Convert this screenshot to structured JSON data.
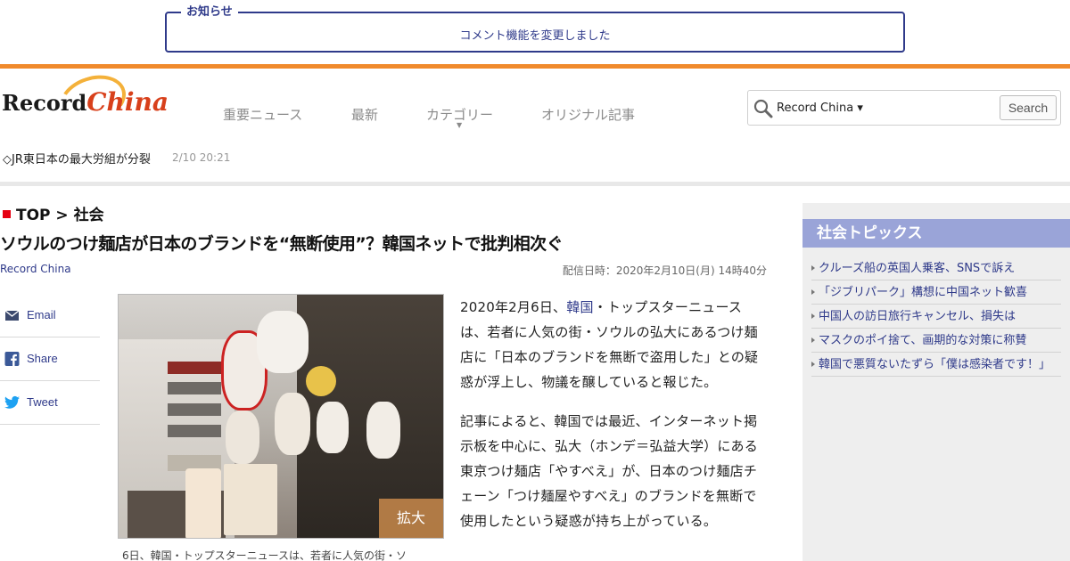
{
  "notice": {
    "label": "お知らせ",
    "text": "コメント機能を変更しました"
  },
  "brand": {
    "logo_text_left": "Record",
    "logo_text_right": "China",
    "accent_orange": "#f08a2c",
    "accent_navy": "#2f3a8a"
  },
  "nav": {
    "items": [
      "重要ニュース",
      "最新",
      "カテゴリー",
      "オリジナル記事"
    ]
  },
  "search": {
    "scope": "Record China ▾",
    "button": "Search"
  },
  "ticker": {
    "text": "◇JR東日本の最大労組が分裂",
    "time": "2/10 20:21"
  },
  "breadcrumb": {
    "top": "TOP",
    "sep": " > ",
    "section": "社会"
  },
  "article": {
    "title": "ソウルのつけ麺店が日本のブランドを“無断使用”？韓国ネットで批判相次ぐ",
    "source": "Record China",
    "pubdate": "配信日時：2020年2月10日(月) 14時40分",
    "photo_expand": "拡大",
    "caption": "6日、韓国・トップスターニュースは、若者に人気の街・ソ",
    "p1_before": "2020年2月6日、",
    "p1_link": "韓国",
    "p1_after": "・トップスターニュースは、若者に人気の街・ソウルの弘大にあるつけ麺店に「日本のブランドを無断で盗用した」との疑惑が浮上し、物議を醸していると報じた。",
    "p2": "記事によると、韓国では最近、インターネット掲示板を中心に、弘大（ホンデ＝弘益大学）にある東京つけ麺店「やすべえ」が、日本のつけ麺店チェーン「つけ麺屋やすべえ」のブランドを無断で使用したという疑惑が持ち上がっている。"
  },
  "share": {
    "email": "Email",
    "share": "Share",
    "tweet": "Tweet"
  },
  "sidebar": {
    "title": "社会トピックス",
    "topics": [
      "クルーズ船の英国人乗客、SNSで訴え",
      "「ジブリパーク」構想に中国ネット歓喜",
      "中国人の訪日旅行キャンセル、損失は",
      "マスクのポイ捨て、画期的な対策に称賛",
      "韓国で悪質ないたずら「僕は感染者です！」"
    ]
  }
}
